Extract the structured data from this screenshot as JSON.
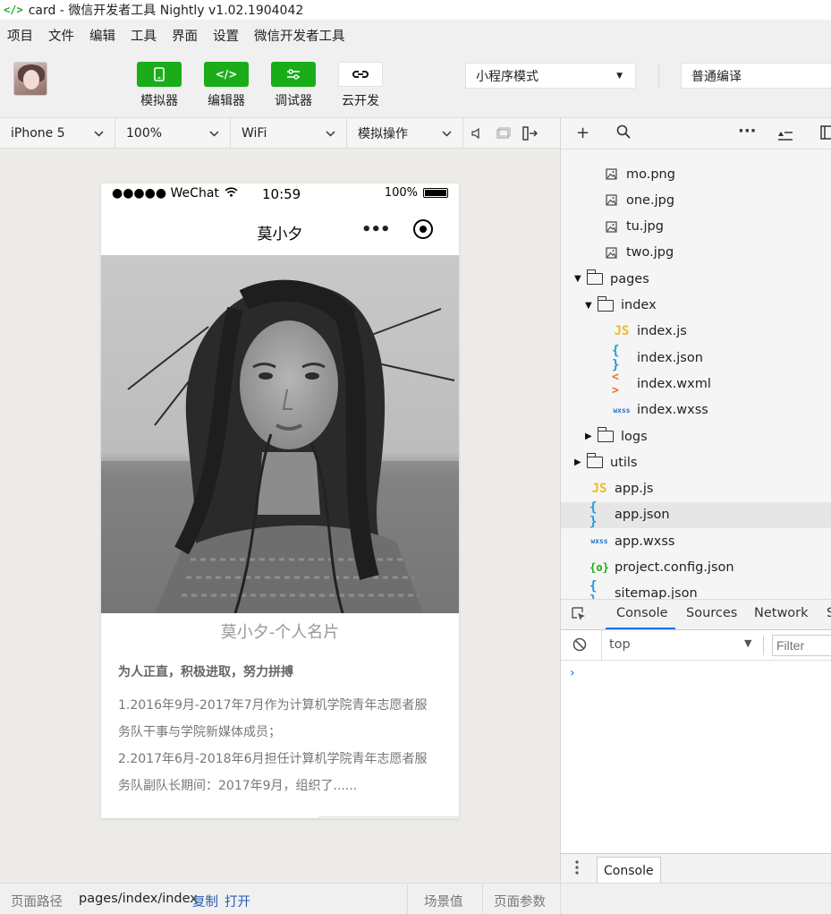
{
  "window": {
    "title": "card - 微信开发者工具 Nightly v1.02.1904042",
    "logo_icon": "code-brackets-icon"
  },
  "menu": [
    "项目",
    "文件",
    "编辑",
    "工具",
    "界面",
    "设置",
    "微信开发者工具"
  ],
  "toolbar": {
    "simulator_label": "模拟器",
    "editor_label": "编辑器",
    "debugger_label": "调试器",
    "cloud_label": "云开发",
    "mode_select": "小程序模式",
    "compile_select": "普通编译",
    "accent_color": "#1aad19"
  },
  "simbar": {
    "device": "iPhone 5",
    "zoom": "100%",
    "network": "WiFi",
    "operation": "模拟操作"
  },
  "phone": {
    "carrier": "●●●●● WeChat",
    "time": "10:59",
    "battery": "100%",
    "battery_level": 1.0,
    "nav_title": "莫小夕",
    "capsule_more": "•••",
    "card_title": "莫小夕-个人名片",
    "motto": "为人正直，积极进取，努力拼搏",
    "lines": [
      "1.2016年9月-2017年7月作为计算机学院青年志愿者服",
      "务队干事与学院新媒体成员；",
      "2.2017年6月-2018年6月担任计算机学院青年志愿者服",
      "务队副队长期间：2017年9月，组织了......"
    ]
  },
  "explorer": {
    "files": [
      {
        "name": "mo.png",
        "type": "img"
      },
      {
        "name": "one.jpg",
        "type": "img"
      },
      {
        "name": "tu.jpg",
        "type": "img"
      },
      {
        "name": "two.jpg",
        "type": "img"
      },
      {
        "name": "pages",
        "type": "folder-open"
      },
      {
        "name": "index",
        "type": "folder-open"
      },
      {
        "name": "index.js",
        "type": "js"
      },
      {
        "name": "index.json",
        "type": "json"
      },
      {
        "name": "index.wxml",
        "type": "wxml"
      },
      {
        "name": "index.wxss",
        "type": "wxss"
      },
      {
        "name": "logs",
        "type": "folder"
      },
      {
        "name": "utils",
        "type": "folder"
      },
      {
        "name": "app.js",
        "type": "js"
      },
      {
        "name": "app.json",
        "type": "json"
      },
      {
        "name": "app.wxss",
        "type": "wxss"
      },
      {
        "name": "project.config.json",
        "type": "cfg"
      },
      {
        "name": "sitemap.json",
        "type": "json"
      }
    ],
    "selected": "app.json",
    "icon_glyphs": {
      "js": "JS",
      "json": "{ }",
      "wxml": "< >",
      "wxss": "wxss",
      "cfg": "{o}"
    }
  },
  "console": {
    "tabs": [
      "Console",
      "Sources",
      "Network",
      "S"
    ],
    "active_tab": "Console",
    "context": "top",
    "filter_placeholder": "Filter",
    "prompt": "›",
    "drawer_tab": "Console"
  },
  "footer": {
    "path_label": "页面路径",
    "path": "pages/index/index",
    "copy": "复制",
    "open": "打开",
    "scene": "场景值",
    "params": "页面参数"
  }
}
